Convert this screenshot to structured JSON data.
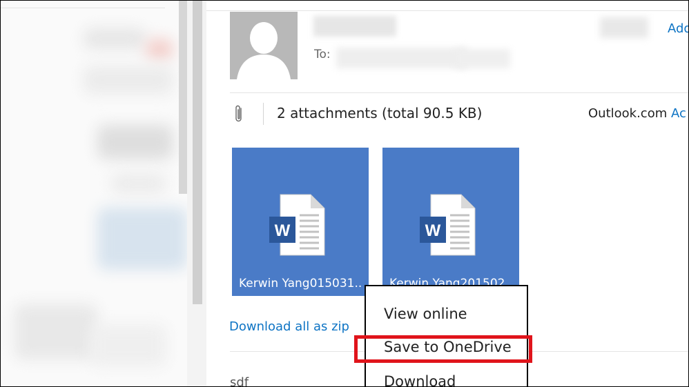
{
  "header": {
    "to_label": "To:",
    "add_link": "Add"
  },
  "attachments": {
    "summary": "2 attachments (total 90.5 KB)",
    "source_prefix": "Outlook.com",
    "source_link": "Ac",
    "files": [
      {
        "name": "Kerwin Yang015031..",
        "icon": "word-doc-icon"
      },
      {
        "name": "Kerwin Yang201502",
        "icon": "word-doc-icon"
      }
    ],
    "download_all": "Download all as zip"
  },
  "message": {
    "body_preview": "sdf"
  },
  "context_menu": {
    "items": [
      "View online",
      "Save to OneDrive",
      "Download"
    ],
    "highlighted": "Save to OneDrive",
    "highlight_color": "#e0141b"
  },
  "colors": {
    "tile": "#4a7bc7",
    "link": "#0e74c4",
    "avatar": "#b8b8b8"
  }
}
